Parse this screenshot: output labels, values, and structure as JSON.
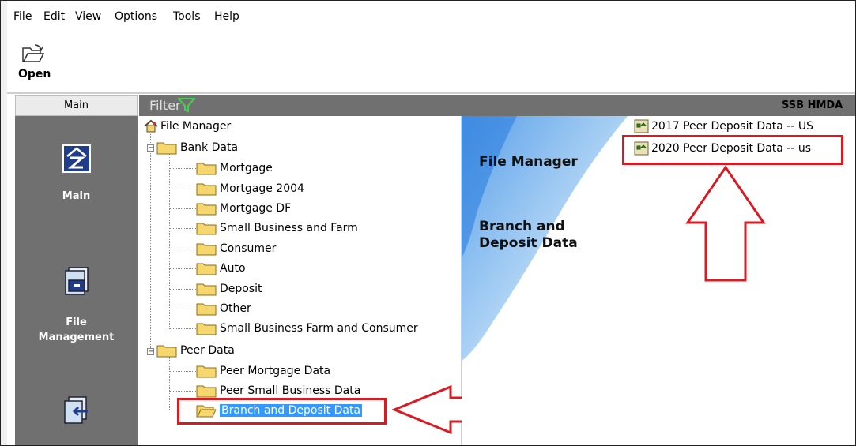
{
  "menu": [
    "File",
    "Edit",
    "View",
    "Options",
    "Tools",
    "Help"
  ],
  "toolbar": {
    "open_label": "Open",
    "open_icon": "folder-open-icon"
  },
  "nav": {
    "tab_label": "Main",
    "items": [
      {
        "label": "Main",
        "icon": "main-z-icon"
      },
      {
        "label": "File\nManagement",
        "icon": "file-cabinet-icon"
      },
      {
        "label": "",
        "icon": "import-icon"
      }
    ]
  },
  "filter": {
    "label": "Filter",
    "icon": "funnel-icon",
    "title_right": "SSB HMDA"
  },
  "tree": {
    "root": "File Manager",
    "bank_data": {
      "label": "Bank Data",
      "children": [
        "Mortgage",
        "Mortgage 2004",
        "Mortgage DF",
        "Small Business and Farm",
        "Consumer",
        "Auto",
        "Deposit",
        "Other",
        "Small Business Farm and Consumer"
      ]
    },
    "peer_data": {
      "label": "Peer Data",
      "children": [
        "Peer Mortgage Data",
        "Peer Small Business Data",
        "Branch and Deposit Data"
      ],
      "selected_index": 2
    }
  },
  "content": {
    "section1": "File Manager",
    "section2": "Branch and\nDeposit Data",
    "files": [
      "2017 Peer Deposit Data -- US",
      "2020 Peer Deposit Data -- us"
    ]
  },
  "colors": {
    "highlight": "#d81b23",
    "selection": "#3399ff",
    "nav_bg": "#707070"
  }
}
